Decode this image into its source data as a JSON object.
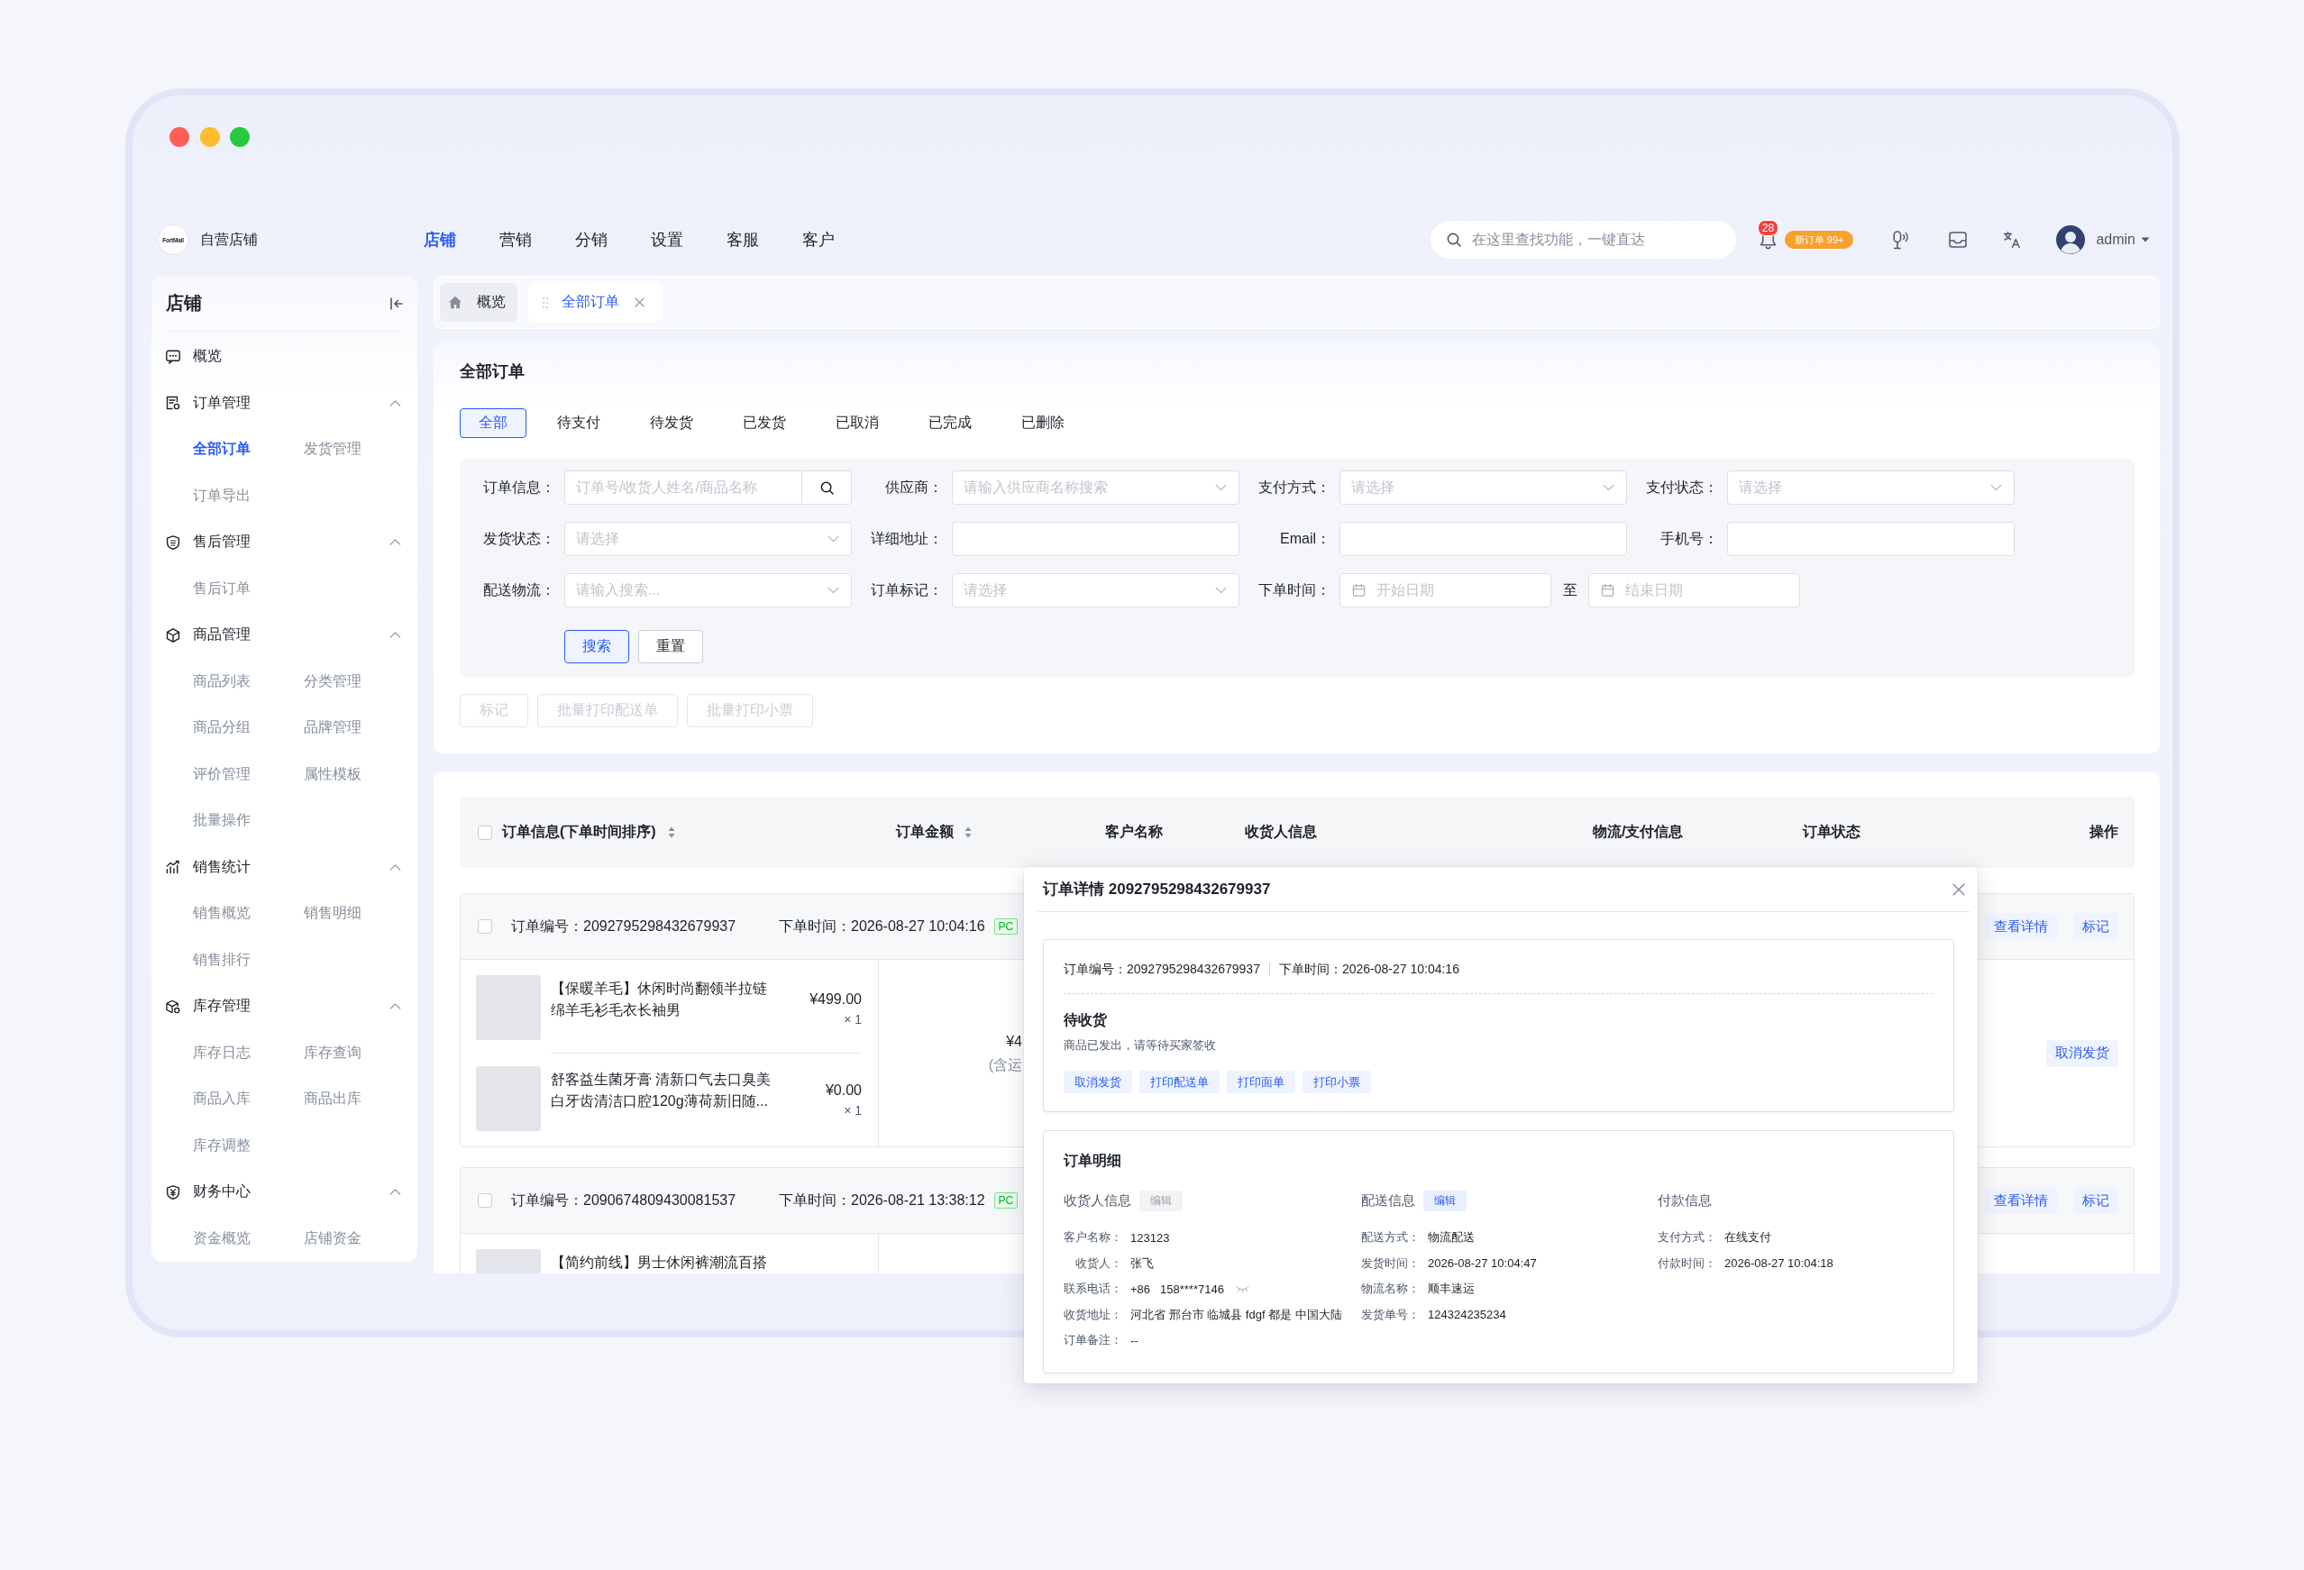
{
  "top_bar": {
    "brand": {
      "logo_text": "FortMall",
      "name": "自营店铺"
    },
    "nav": [
      {
        "label": "店铺",
        "selected": true
      },
      {
        "label": "营销",
        "selected": false
      },
      {
        "label": "分销",
        "selected": false
      },
      {
        "label": "设置",
        "selected": false
      },
      {
        "label": "客服",
        "selected": false
      },
      {
        "label": "客户",
        "selected": false
      }
    ],
    "search": {
      "placeholder": "在这里查找功能，一键直达"
    },
    "notifications": {
      "count": "28",
      "new_orders": "新订单 99+"
    },
    "user": {
      "name": "admin"
    }
  },
  "sidebar": {
    "title": "店铺",
    "items": [
      {
        "kind": "link",
        "label": "概览"
      },
      {
        "kind": "group",
        "label": "订单管理",
        "expanded": true,
        "children": [
          {
            "label": "全部订单",
            "selected": true
          },
          {
            "label": "发货管理",
            "selected": false
          },
          {
            "label": "订单导出",
            "selected": false
          }
        ]
      },
      {
        "kind": "group",
        "label": "售后管理",
        "expanded": true,
        "children": [
          {
            "label": "售后订单",
            "selected": false
          }
        ]
      },
      {
        "kind": "group",
        "label": "商品管理",
        "expanded": true,
        "children": [
          {
            "label": "商品列表",
            "selected": false
          },
          {
            "label": "分类管理",
            "selected": false
          },
          {
            "label": "商品分组",
            "selected": false
          },
          {
            "label": "品牌管理",
            "selected": false
          },
          {
            "label": "评价管理",
            "selected": false
          },
          {
            "label": "属性模板",
            "selected": false
          },
          {
            "label": "批量操作",
            "selected": false
          }
        ]
      },
      {
        "kind": "group",
        "label": "销售统计",
        "expanded": true,
        "children": [
          {
            "label": "销售概览",
            "selected": false
          },
          {
            "label": "销售明细",
            "selected": false
          },
          {
            "label": "销售排行",
            "selected": false
          }
        ]
      },
      {
        "kind": "group",
        "label": "库存管理",
        "expanded": true,
        "children": [
          {
            "label": "库存日志",
            "selected": false
          },
          {
            "label": "库存查询",
            "selected": false
          },
          {
            "label": "商品入库",
            "selected": false
          },
          {
            "label": "商品出库",
            "selected": false
          },
          {
            "label": "库存调整",
            "selected": false
          }
        ]
      },
      {
        "kind": "group",
        "label": "财务中心",
        "expanded": true,
        "children": [
          {
            "label": "资金概览",
            "selected": false
          },
          {
            "label": "店铺资金",
            "selected": false
          }
        ]
      }
    ]
  },
  "page_tabs": [
    {
      "kind": "home",
      "label": "概览",
      "selected": false
    },
    {
      "kind": "page",
      "label": "全部订单",
      "selected": true
    }
  ],
  "order_filters": {
    "title": "全部订单",
    "status_tabs": [
      {
        "label": "全部",
        "selected": true
      },
      {
        "label": "待支付",
        "selected": false
      },
      {
        "label": "待发货",
        "selected": false
      },
      {
        "label": "已发货",
        "selected": false
      },
      {
        "label": "已取消",
        "selected": false
      },
      {
        "label": "已完成",
        "selected": false
      },
      {
        "label": "已删除",
        "selected": false
      }
    ],
    "fields": [
      {
        "kind": "search",
        "label": "订单信息：",
        "placeholder": "订单号/收货人姓名/商品名称"
      },
      {
        "kind": "select",
        "label": "供应商：",
        "placeholder": "请输入供应商名称搜索"
      },
      {
        "kind": "select",
        "label": "支付方式：",
        "placeholder": "请选择"
      },
      {
        "kind": "select",
        "label": "支付状态：",
        "placeholder": "请选择"
      },
      {
        "kind": "select",
        "label": "发货状态：",
        "placeholder": "请选择"
      },
      {
        "kind": "text",
        "label": "详细地址："
      },
      {
        "kind": "text",
        "label": "Email："
      },
      {
        "kind": "text",
        "label": "手机号："
      },
      {
        "kind": "select",
        "label": "配送物流：",
        "placeholder": "请输入搜索..."
      },
      {
        "kind": "select",
        "label": "订单标记：",
        "placeholder": "请选择"
      },
      {
        "kind": "date_range",
        "label": "下单时间：",
        "start_placeholder": "开始日期",
        "separator": "至",
        "end_placeholder": "结束日期"
      }
    ],
    "buttons": [
      {
        "kind": "primary",
        "label": "搜索"
      },
      {
        "kind": "default",
        "label": "重置"
      }
    ],
    "bulk_actions": [
      {
        "label": "标记",
        "disabled": true
      },
      {
        "label": "批量打印配送单",
        "disabled": true
      },
      {
        "label": "批量打印小票",
        "disabled": true
      }
    ]
  },
  "order_table": {
    "select_all": {
      "checked": false
    },
    "columns": [
      {
        "label": "订单信息(下单时间排序)",
        "sortable": true
      },
      {
        "label": "订单金额",
        "sortable": true
      },
      {
        "label": "客户名称",
        "sortable": false
      },
      {
        "label": "收货人信息",
        "sortable": false
      },
      {
        "label": "物流/支付信息",
        "sortable": false
      },
      {
        "label": "订单状态",
        "sortable": false
      },
      {
        "label": "操作",
        "sortable": false
      }
    ],
    "orders": [
      {
        "checked": false,
        "order_no": "订单编号：2092795298432679937",
        "created": "下单时间：2026-08-27 10:04:16",
        "source": "PC",
        "actions": [
          "查看详情",
          "标记"
        ],
        "items": [
          {
            "title": "【保暖羊毛】休闲时尚翻领半拉链绵羊毛衫毛衣长袖男",
            "price": "¥499.00",
            "quantity": "× 1"
          },
          {
            "title": "舒客益生菌牙膏 清新口气去口臭美白牙齿清洁口腔120g薄荷新旧随...",
            "price": "¥0.00",
            "quantity": "× 1"
          }
        ],
        "amount": "¥4",
        "amount_note": "(含运",
        "status_action": "取消发货"
      },
      {
        "checked": false,
        "order_no": "订单编号：2090674809430081537",
        "created": "下单时间：2026-08-21 13:38:12",
        "source": "PC",
        "actions": [
          "查看详情",
          "标记"
        ],
        "items": [
          {
            "title": "【简约前线】男士休闲裤潮流百搭"
          }
        ]
      }
    ]
  },
  "order_detail_dialog": {
    "title": "订单详情 2092795298432679937",
    "summary": {
      "order_no": "订单编号：2092795298432679937",
      "created": "下单时间：2026-08-27 10:04:16"
    },
    "status": {
      "title": "待收货",
      "message": "商品已发出，请等待买家签收",
      "actions": [
        "取消发货",
        "打印配送单",
        "打印面单",
        "打印小票"
      ]
    },
    "details": {
      "title": "订单明细",
      "sections": [
        {
          "title": "收货人信息",
          "edit": {
            "label": "编辑",
            "disabled": true
          },
          "fields": [
            {
              "label": "客户名称：",
              "value": "123123"
            },
            {
              "label": "收货人：",
              "value": "张飞"
            },
            {
              "label": "联系电话：",
              "prefix": "+86",
              "value": "158****7146",
              "masked": true
            },
            {
              "label": "收货地址：",
              "value": "河北省 邢台市 临城县 fdgf 都是 中国大陆"
            },
            {
              "label": "订单备注：",
              "value": "--"
            }
          ]
        },
        {
          "title": "配送信息",
          "edit": {
            "label": "编辑",
            "disabled": false
          },
          "fields": [
            {
              "label": "配送方式：",
              "value": "物流配送"
            },
            {
              "label": "发货时间：",
              "value": "2026-08-27 10:04:47"
            },
            {
              "label": "物流名称：",
              "value": "顺丰速运"
            },
            {
              "label": "发货单号：",
              "value": "124324235234"
            }
          ]
        },
        {
          "title": "付款信息",
          "fields": [
            {
              "label": "支付方式：",
              "value": "在线支付"
            },
            {
              "label": "付款时间：",
              "value": "2026-08-27 10:04:18"
            }
          ]
        }
      ]
    }
  }
}
